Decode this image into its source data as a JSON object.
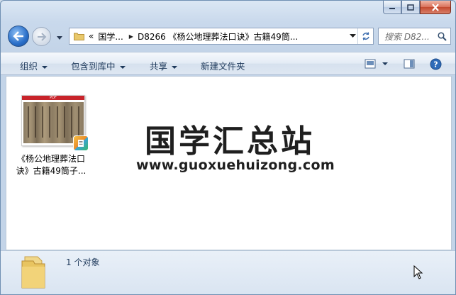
{
  "window": {
    "caption_buttons": [
      "minimize",
      "maximize",
      "close"
    ]
  },
  "nav": {
    "address": {
      "prefix": "«",
      "segment1": "国学...",
      "segment2": "D8266 《杨公地理葬法口诀》古籍49筒..."
    },
    "search_placeholder": "搜索 D82..."
  },
  "toolbar": {
    "organize": "组织",
    "include_library": "包含到库中",
    "share": "共享",
    "new_folder": "新建文件夹"
  },
  "file": {
    "name_line1": "《杨公地理葬法口",
    "name_line2": "诀》古籍49筒子...",
    "thumb_label": "PDF"
  },
  "watermark": {
    "title": "国学汇总站",
    "url": "www.guoxuehuizong.com"
  },
  "details": {
    "count": "1 个对象"
  },
  "colors": {
    "accent": "#2a6fc9",
    "text": "#1e395b",
    "pdf_red": "#c8232a"
  }
}
